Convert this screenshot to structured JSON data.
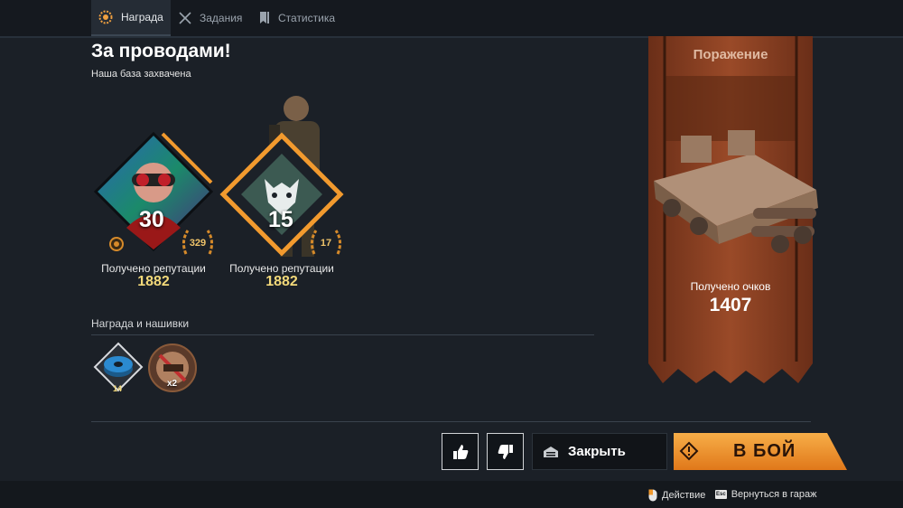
{
  "tabs": [
    {
      "label": "Награда",
      "icon": "reward-icon",
      "active": true
    },
    {
      "label": "Задания",
      "icon": "crossed-swords-icon",
      "active": false
    },
    {
      "label": "Статистика",
      "icon": "stats-bookmark-icon",
      "active": false
    }
  ],
  "header": {
    "title": "За проводами!",
    "subtitle": "Наша база захвачена"
  },
  "player_card": {
    "level": "30",
    "laurel_value": "329",
    "reputation_label": "Получено репутации",
    "reputation_value": "1882"
  },
  "faction_card": {
    "level": "15",
    "laurel_value": "17",
    "reputation_label": "Получено репутации",
    "reputation_value": "1882"
  },
  "rewards": {
    "label": "Награда и нашивки",
    "items": [
      {
        "icon": "wire-spool-icon",
        "count": "14"
      },
      {
        "icon": "patch-icon",
        "count": "x2"
      }
    ]
  },
  "result": {
    "title": "Поражение",
    "score_label": "Получено очков",
    "score_value": "1407"
  },
  "actions": {
    "close_label": "Закрыть",
    "fight_label": "В БОЙ"
  },
  "footer": {
    "action_hint": "Действие",
    "garage_hint": "Вернуться в гараж",
    "esc_key": "Esc"
  },
  "colors": {
    "accent_orange": "#f29a2e",
    "banner_rust": "#8a3f22",
    "gold_text": "#f3d97a",
    "background": "#1b2027"
  }
}
